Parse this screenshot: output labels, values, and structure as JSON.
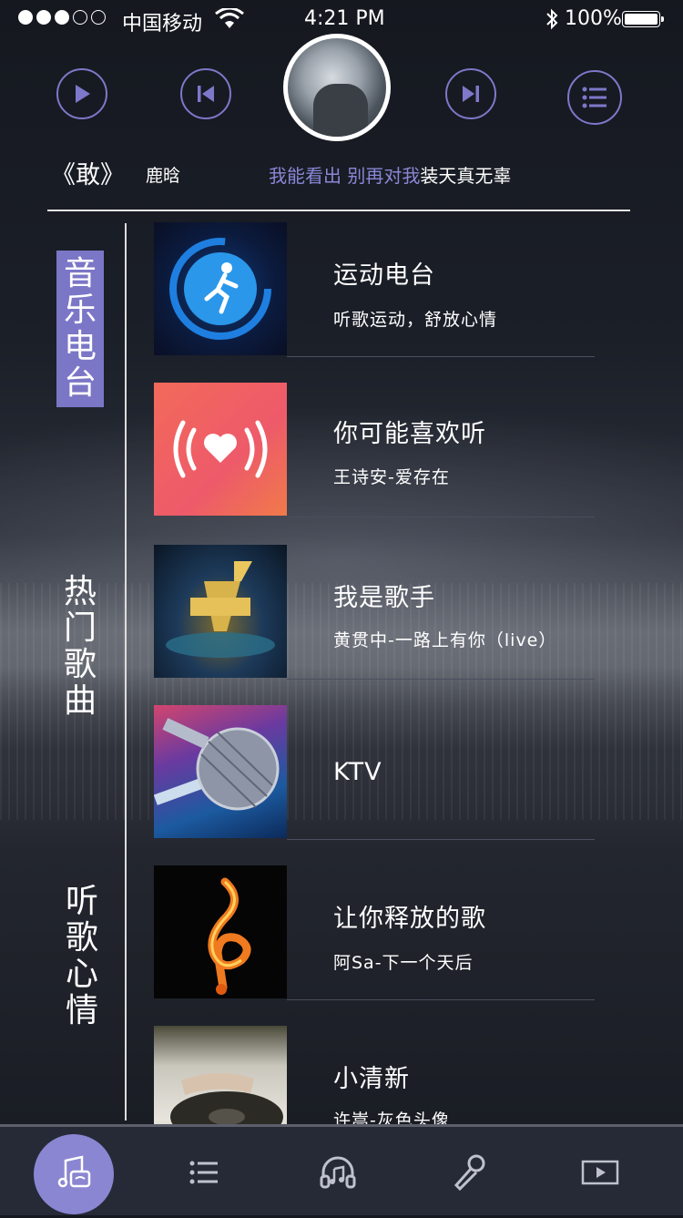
{
  "status": {
    "carrier": "中国移动",
    "time": "4:21 PM",
    "battery": "100%"
  },
  "player": {
    "title": "《敢》",
    "artist": "鹿晗",
    "lyric_highlight": "我能看出  别再对我",
    "lyric_rest": "装天真无辜"
  },
  "nav": {
    "items": [
      {
        "label": [
          "音",
          "乐",
          "电",
          "台"
        ],
        "active": true
      },
      {
        "label": [
          "热",
          "门",
          "歌",
          "曲"
        ],
        "active": false
      },
      {
        "label": [
          "听",
          "歌",
          "心",
          "情"
        ],
        "active": false
      }
    ]
  },
  "list": [
    {
      "title": "运动电台",
      "subtitle": "听歌运动，舒放心情"
    },
    {
      "title": "你可能喜欢听",
      "subtitle": "王诗安-爱存在"
    },
    {
      "title": "我是歌手",
      "subtitle": "黄贯中-一路上有你（live）"
    },
    {
      "title": "KTV",
      "subtitle": ""
    },
    {
      "title": "让你释放的歌",
      "subtitle": "阿Sa-下一个天后"
    },
    {
      "title": "小清新",
      "subtitle": "许嵩-灰色头像"
    }
  ],
  "colors": {
    "accent": "#7b76c6",
    "tabbar": "#262a36"
  },
  "tabs": [
    {
      "icon": "music-note-icon",
      "active": true
    },
    {
      "icon": "list-icon",
      "active": false
    },
    {
      "icon": "headphones-icon",
      "active": false
    },
    {
      "icon": "microphone-icon",
      "active": false
    },
    {
      "icon": "video-play-icon",
      "active": false
    }
  ]
}
